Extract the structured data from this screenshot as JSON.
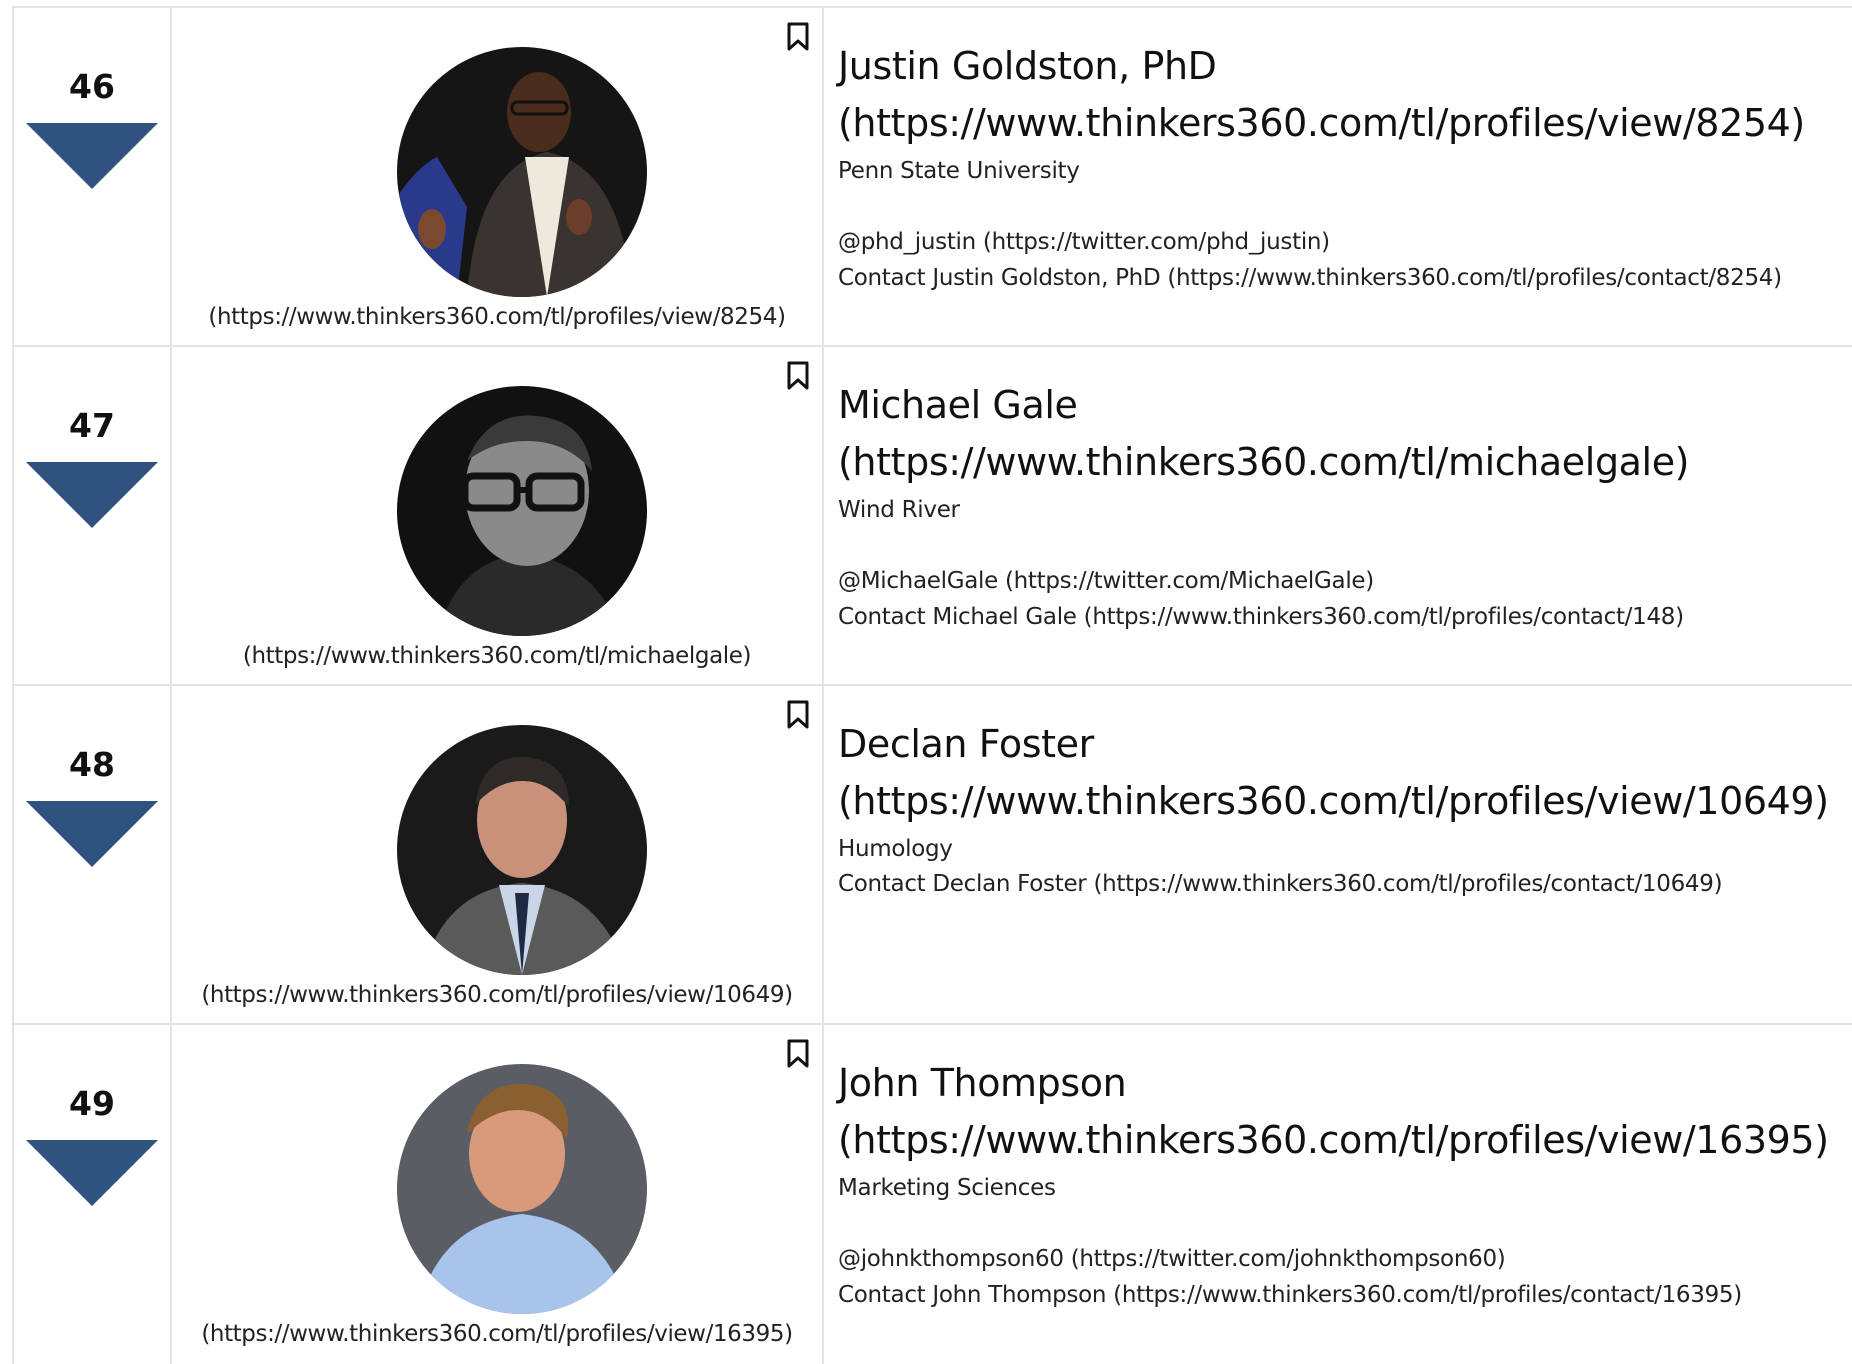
{
  "colors": {
    "arrow": "#2f527f",
    "border": "#e3e3e3"
  },
  "rows": [
    {
      "rank": "46",
      "photo_url": "(https://www.thinkers360.com/tl/profiles/view/8254)",
      "name": "Justin Goldston, PhD",
      "profile_url": "(https://www.thinkers360.com/tl/profiles/view/8254)",
      "company": "Penn State University",
      "twitter": "@phd_justin (https://twitter.com/phd_justin)",
      "contact": "Contact Justin Goldston, PhD (https://www.thinkers360.com/tl/profiles/contact/8254)"
    },
    {
      "rank": "47",
      "photo_url": "(https://www.thinkers360.com/tl/michaelgale)",
      "name": "Michael Gale",
      "profile_url": "(https://www.thinkers360.com/tl/michaelgale)",
      "company": "Wind River",
      "twitter": "@MichaelGale (https://twitter.com/MichaelGale)",
      "contact": "Contact Michael Gale (https://www.thinkers360.com/tl/profiles/contact/148)"
    },
    {
      "rank": "48",
      "photo_url": "(https://www.thinkers360.com/tl/profiles/view/10649)",
      "name": "Declan Foster",
      "profile_url": "(https://www.thinkers360.com/tl/profiles/view/10649)",
      "company": "Humology",
      "twitter": "",
      "contact": "Contact Declan Foster (https://www.thinkers360.com/tl/profiles/contact/10649)"
    },
    {
      "rank": "49",
      "photo_url": "(https://www.thinkers360.com/tl/profiles/view/16395)",
      "name": "John Thompson",
      "profile_url": "(https://www.thinkers360.com/tl/profiles/view/16395)",
      "company": "Marketing Sciences",
      "twitter": "@johnkthompson60 (https://twitter.com/johnkthompson60)",
      "contact": "Contact John Thompson (https://www.thinkers360.com/tl/profiles/contact/16395)"
    }
  ]
}
